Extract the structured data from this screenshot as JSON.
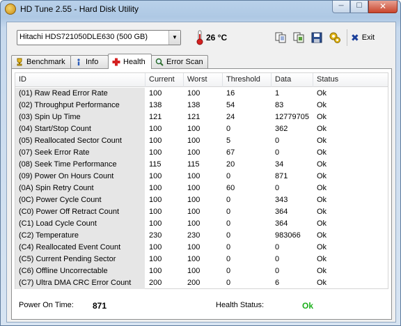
{
  "window": {
    "title": "HD Tune 2.55 - Hard Disk Utility"
  },
  "toolbar": {
    "drive": "Hitachi HDS721050DLE630 (500 GB)",
    "temperature": "26 °C",
    "exit_label": "Exit",
    "icons": [
      "copy-text-icon",
      "copy-screenshot-icon",
      "save-icon",
      "options-icon"
    ]
  },
  "tabs": [
    {
      "label": "Benchmark",
      "icon": "benchmark-icon"
    },
    {
      "label": "Info",
      "icon": "info-icon"
    },
    {
      "label": "Health",
      "icon": "health-icon",
      "active": true
    },
    {
      "label": "Error Scan",
      "icon": "error-scan-icon"
    }
  ],
  "columns": [
    "ID",
    "Current",
    "Worst",
    "Threshold",
    "Data",
    "Status"
  ],
  "rows": [
    [
      "(01) Raw Read Error Rate",
      "100",
      "100",
      "16",
      "1",
      "Ok"
    ],
    [
      "(02) Throughput Performance",
      "138",
      "138",
      "54",
      "83",
      "Ok"
    ],
    [
      "(03) Spin Up Time",
      "121",
      "121",
      "24",
      "12779705",
      "Ok"
    ],
    [
      "(04) Start/Stop Count",
      "100",
      "100",
      "0",
      "362",
      "Ok"
    ],
    [
      "(05) Reallocated Sector Count",
      "100",
      "100",
      "5",
      "0",
      "Ok"
    ],
    [
      "(07) Seek Error Rate",
      "100",
      "100",
      "67",
      "0",
      "Ok"
    ],
    [
      "(08) Seek Time Performance",
      "115",
      "115",
      "20",
      "34",
      "Ok"
    ],
    [
      "(09) Power On Hours Count",
      "100",
      "100",
      "0",
      "871",
      "Ok"
    ],
    [
      "(0A) Spin Retry Count",
      "100",
      "100",
      "60",
      "0",
      "Ok"
    ],
    [
      "(0C) Power Cycle Count",
      "100",
      "100",
      "0",
      "343",
      "Ok"
    ],
    [
      "(C0) Power Off Retract Count",
      "100",
      "100",
      "0",
      "364",
      "Ok"
    ],
    [
      "(C1) Load Cycle Count",
      "100",
      "100",
      "0",
      "364",
      "Ok"
    ],
    [
      "(C2) Temperature",
      "230",
      "230",
      "0",
      "983066",
      "Ok"
    ],
    [
      "(C4) Reallocated Event Count",
      "100",
      "100",
      "0",
      "0",
      "Ok"
    ],
    [
      "(C5) Current Pending Sector",
      "100",
      "100",
      "0",
      "0",
      "Ok"
    ],
    [
      "(C6) Offline Uncorrectable",
      "100",
      "100",
      "0",
      "0",
      "Ok"
    ],
    [
      "(C7) Ultra DMA CRC Error Count",
      "200",
      "200",
      "0",
      "6",
      "Ok"
    ]
  ],
  "footer": {
    "power_on_label": "Power On Time:",
    "power_on_value": "871",
    "health_label": "Health Status:",
    "health_value": "Ok"
  },
  "colors": {
    "health_ok": "#1cb01c",
    "thermometer": "#d42020"
  }
}
